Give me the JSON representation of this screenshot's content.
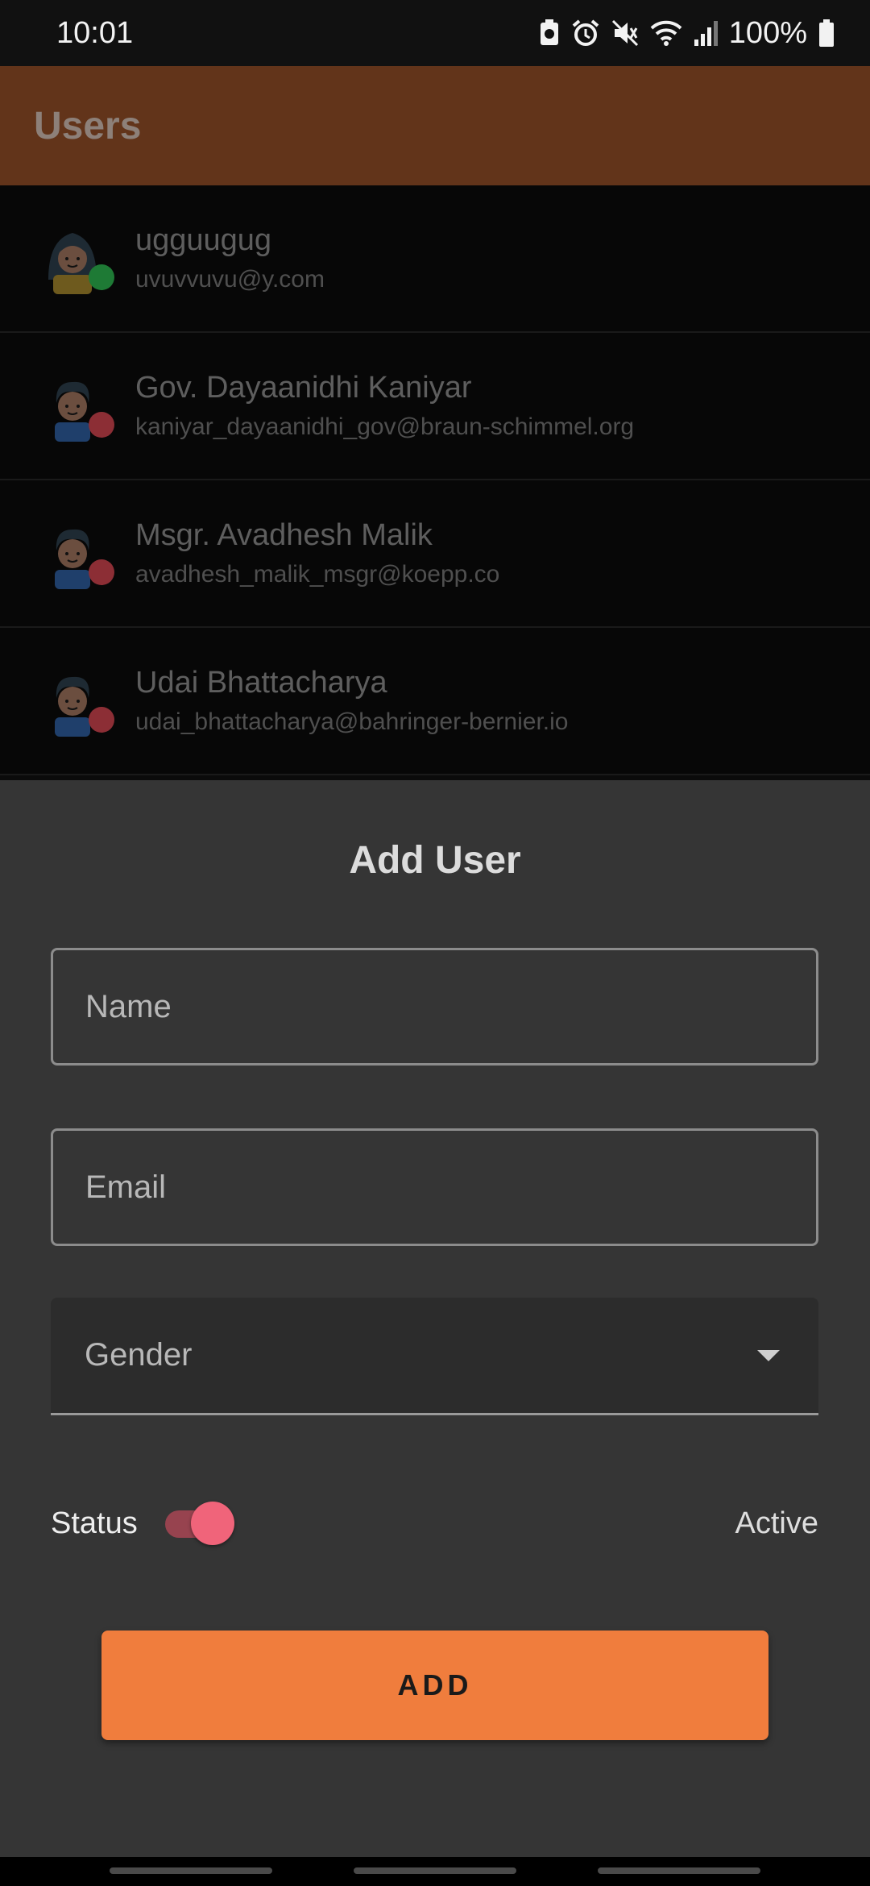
{
  "status_bar": {
    "time": "10:01",
    "battery": "100%",
    "icons": [
      "battery-saver-icon",
      "alarm-icon",
      "mute-icon",
      "wifi-icon",
      "signal-icon",
      "battery-icon"
    ]
  },
  "app_bar": {
    "title": "Users"
  },
  "users": [
    {
      "name": "ugguugug",
      "email": "uvuvvuvu@y.com",
      "avatar": "female-avatar-icon",
      "status_color": "#1e7a35"
    },
    {
      "name": "Gov. Dayaanidhi Kaniyar",
      "email": "kaniyar_dayaanidhi_gov@braun-schimmel.org",
      "avatar": "male-avatar-icon",
      "status_color": "#8c2e35"
    },
    {
      "name": "Msgr. Avadhesh Malik",
      "email": "avadhesh_malik_msgr@koepp.co",
      "avatar": "male-avatar-icon",
      "status_color": "#8c2e35"
    },
    {
      "name": "Udai Bhattacharya",
      "email": "udai_bhattacharya@bahringer-bernier.io",
      "avatar": "male-avatar-icon",
      "status_color": "#8c2e35"
    }
  ],
  "sheet": {
    "title": "Add User",
    "name_placeholder": "Name",
    "email_placeholder": "Email",
    "gender_placeholder": "Gender",
    "status_label": "Status",
    "status_value": "Active",
    "status_on": true,
    "add_label": "ADD"
  },
  "colors": {
    "app_bar": "#62341a",
    "accent": "#f07d3d",
    "toggle_on": "#f0647a",
    "active_dot": "#1e7a35",
    "inactive_dot": "#8c2e35"
  }
}
